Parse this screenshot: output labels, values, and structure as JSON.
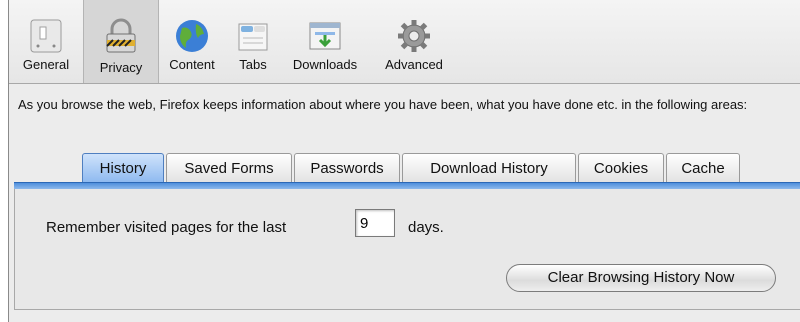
{
  "toolbar": {
    "items": [
      {
        "label": "General",
        "icon": "switch-icon"
      },
      {
        "label": "Privacy",
        "icon": "padlock-icon",
        "selected": true
      },
      {
        "label": "Content",
        "icon": "globe-icon"
      },
      {
        "label": "Tabs",
        "icon": "tabs-icon"
      },
      {
        "label": "Downloads",
        "icon": "downloads-icon"
      },
      {
        "label": "Advanced",
        "icon": "gear-icon"
      }
    ]
  },
  "intro": "As you browse the web, Firefox keeps information about where you have been, what you have done etc. in the following areas:",
  "tabs": [
    {
      "label": "History",
      "active": true
    },
    {
      "label": "Saved Forms"
    },
    {
      "label": "Passwords"
    },
    {
      "label": "Download History"
    },
    {
      "label": "Cookies"
    },
    {
      "label": "Cache"
    }
  ],
  "history": {
    "remember_label": "Remember visited pages for the last",
    "days_value": "9",
    "days_unit": "days.",
    "clear_button": "Clear Browsing History Now"
  },
  "colors": {
    "accent": "#4e8fdc",
    "active_tab": "#8fbaf0",
    "background": "#ececec"
  }
}
